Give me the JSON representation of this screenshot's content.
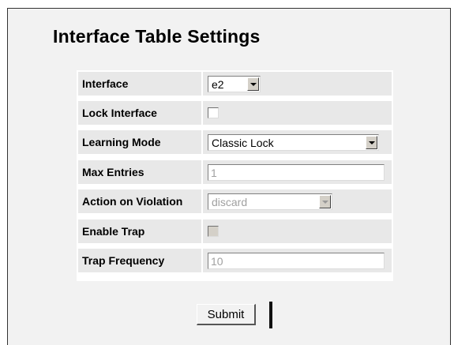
{
  "page": {
    "title": "Interface Table Settings"
  },
  "form": {
    "interface": {
      "label": "Interface",
      "value": "e2"
    },
    "lock_interface": {
      "label": "Lock Interface",
      "checked": false
    },
    "learning_mode": {
      "label": "Learning Mode",
      "value": "Classic Lock"
    },
    "max_entries": {
      "label": "Max Entries",
      "value": "1"
    },
    "action_on_violation": {
      "label": "Action on Violation",
      "value": "discard"
    },
    "enable_trap": {
      "label": "Enable Trap",
      "checked": false
    },
    "trap_frequency": {
      "label": "Trap Frequency",
      "value": "10"
    }
  },
  "actions": {
    "submit_label": "Submit"
  },
  "colors": {
    "frame_background": "#f2f2f2",
    "cell_background": "#e8e8e8",
    "disabled_text": "#a0a0a0"
  }
}
